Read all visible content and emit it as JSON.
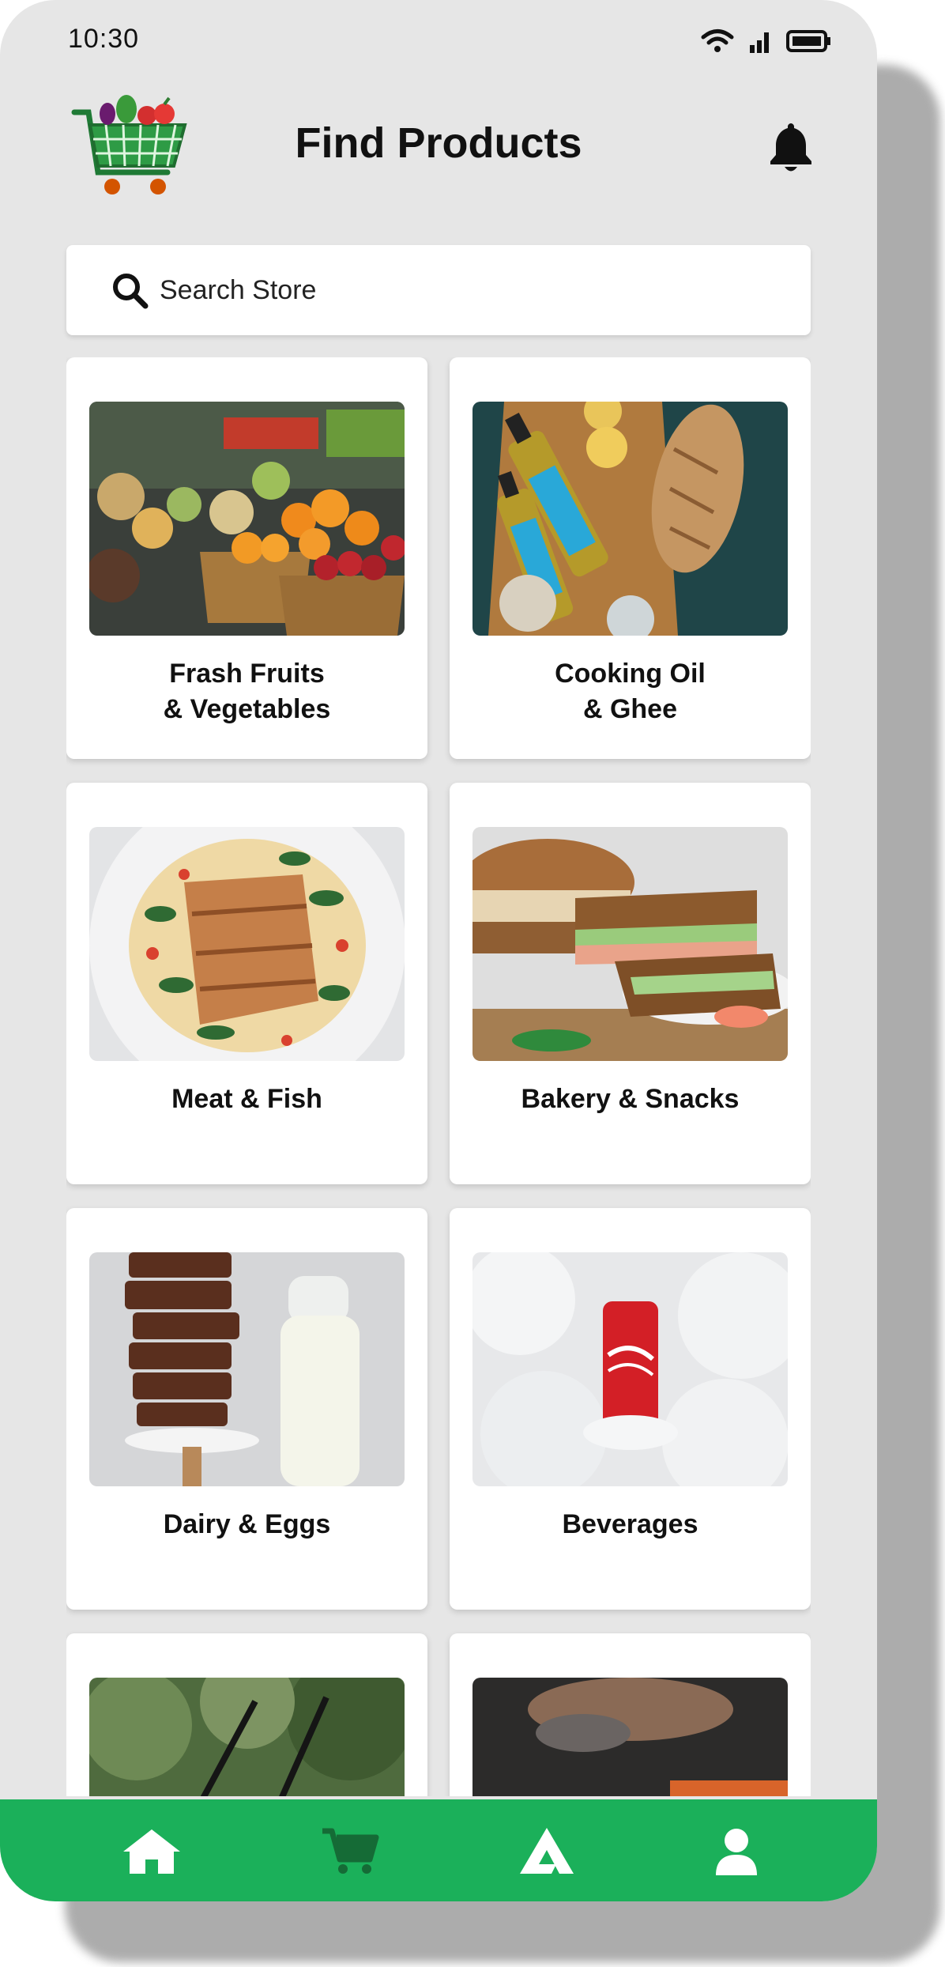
{
  "status_bar": {
    "time": "10:30"
  },
  "header": {
    "title": "Find Products"
  },
  "search": {
    "placeholder": "Search Store"
  },
  "categories": [
    {
      "label_line1": "Frash Fruits",
      "label_line2": "& Vegetables"
    },
    {
      "label_line1": "Cooking Oil",
      "label_line2": "& Ghee"
    },
    {
      "label_line1": "Meat & Fish",
      "label_line2": ""
    },
    {
      "label_line1": "Bakery & Snacks",
      "label_line2": ""
    },
    {
      "label_line1": "Dairy & Eggs",
      "label_line2": ""
    },
    {
      "label_line1": "Beverages",
      "label_line2": ""
    },
    {
      "label_line1": "",
      "label_line2": ""
    },
    {
      "label_line1": "",
      "label_line2": ""
    }
  ],
  "bottom_nav": {
    "items": [
      {
        "icon": "home-icon"
      },
      {
        "icon": "cart-icon"
      },
      {
        "icon": "brand-a-icon"
      },
      {
        "icon": "user-icon"
      }
    ]
  },
  "colors": {
    "accent_green": "#1bb05a",
    "background": "#e6e6e6",
    "card": "#ffffff"
  }
}
